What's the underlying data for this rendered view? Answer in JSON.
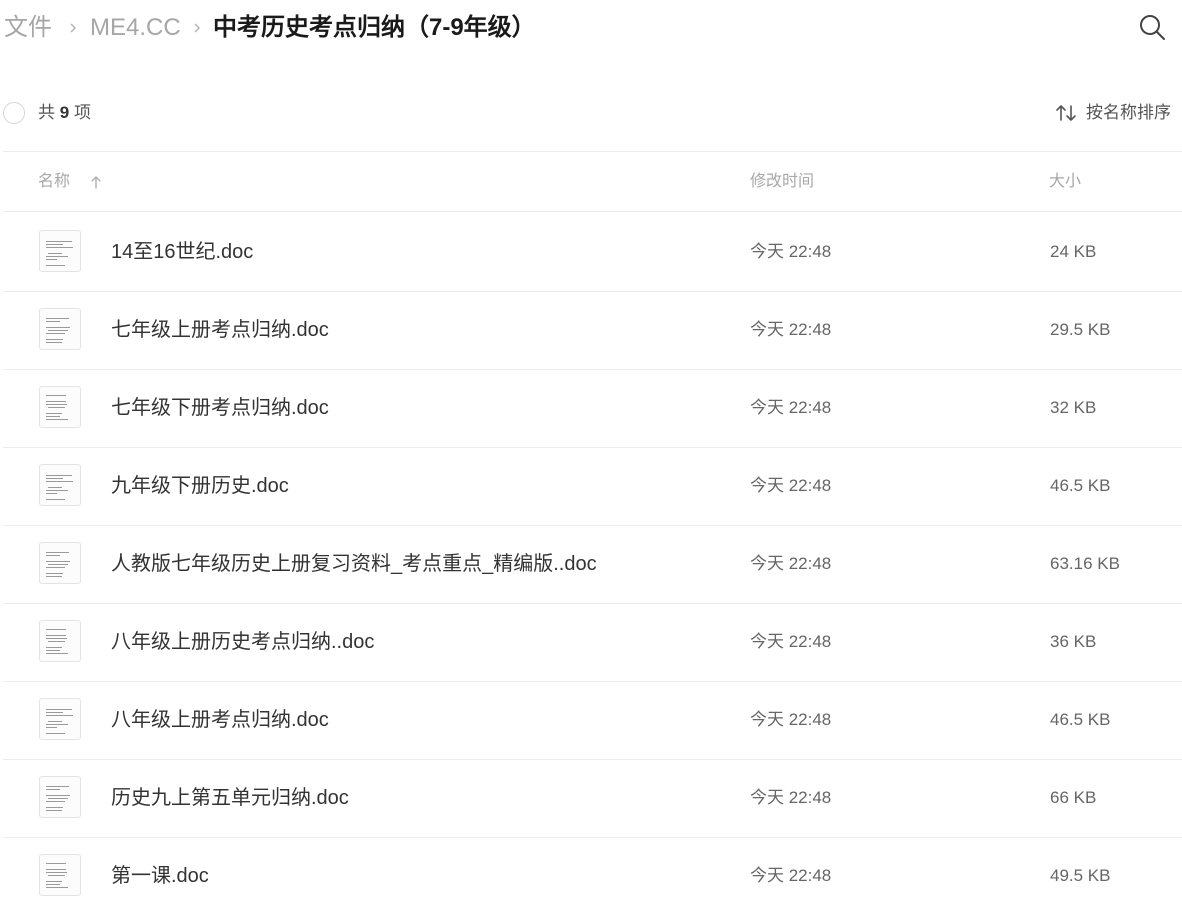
{
  "breadcrumb": {
    "items": [
      "文件",
      "ME4.CC"
    ],
    "current": "中考历史考点归纳（7-9年级）"
  },
  "toolbar": {
    "count_prefix": "共",
    "count_value": "9",
    "count_suffix": "项",
    "sort_label": "按名称排序"
  },
  "columns": {
    "name": "名称",
    "modified": "修改时间",
    "size": "大小"
  },
  "icons": {
    "search": "search-icon",
    "sort": "sort-icon",
    "sort_direction": "arrow-up-icon",
    "file_thumb": "document-thumbnail"
  },
  "files": [
    {
      "name": "14至16世纪.doc",
      "modified": "今天 22:48",
      "size": "24 KB"
    },
    {
      "name": "七年级上册考点归纳.doc",
      "modified": "今天 22:48",
      "size": "29.5 KB"
    },
    {
      "name": "七年级下册考点归纳.doc",
      "modified": "今天 22:48",
      "size": "32 KB"
    },
    {
      "name": "九年级下册历史.doc",
      "modified": "今天 22:48",
      "size": "46.5 KB"
    },
    {
      "name": "人教版七年级历史上册复习资料_考点重点_精编版..doc",
      "modified": "今天 22:48",
      "size": "63.16 KB"
    },
    {
      "name": "八年级上册历史考点归纳..doc",
      "modified": "今天 22:48",
      "size": "36 KB"
    },
    {
      "name": "八年级上册考点归纳.doc",
      "modified": "今天 22:48",
      "size": "46.5 KB"
    },
    {
      "name": "历史九上第五单元归纳.doc",
      "modified": "今天 22:48",
      "size": "66 KB"
    },
    {
      "name": "第一课.doc",
      "modified": "今天 22:48",
      "size": "49.5 KB"
    }
  ]
}
